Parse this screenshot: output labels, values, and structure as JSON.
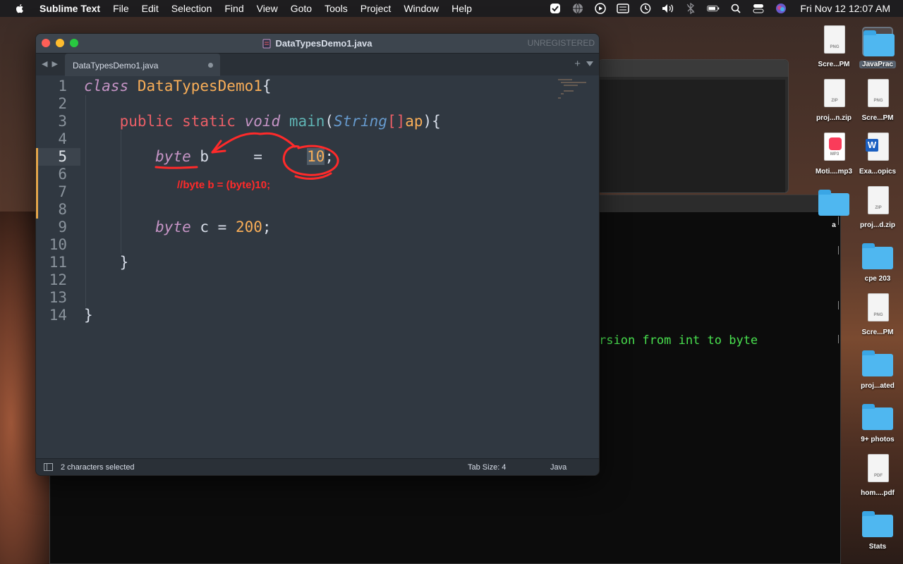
{
  "menubar": {
    "app_name": "Sublime Text",
    "items": [
      "File",
      "Edit",
      "Selection",
      "Find",
      "View",
      "Goto",
      "Tools",
      "Project",
      "Window",
      "Help"
    ],
    "clock": "Fri Nov 12  12:07 AM",
    "status_icons": [
      "checkbox-icon",
      "globe-icon",
      "play-icon",
      "keyboard-icon",
      "time-machine-icon",
      "volume-icon",
      "bluetooth-icon",
      "battery-icon",
      "search-icon",
      "control-center-icon",
      "siri-icon"
    ]
  },
  "editor_window": {
    "title": "DataTypesDemo1.java",
    "unregistered": "UNREGISTERED",
    "tab_label": "DataTypesDemo1.java",
    "line_numbers": [
      "1",
      "2",
      "3",
      "4",
      "5",
      "6",
      "7",
      "8",
      "9",
      "10",
      "11",
      "12",
      "13",
      "14"
    ],
    "active_line": 5,
    "code": {
      "l1_kw": "class",
      "l1_name": "DataTypesDemo1",
      "l1_brace": "{",
      "l3_public": "public",
      "l3_static": "static",
      "l3_void": "void",
      "l3_main": "main",
      "l3_paren_open": "(",
      "l3_string": "String",
      "l3_brackets": "[]",
      "l3_ap": "ap",
      "l3_close": "){",
      "l5_byte": "byte",
      "l5_var": " b     =     ",
      "l5_value": "10",
      "l5_semi": ";",
      "l9_byte": "byte",
      "l9_var": " c = ",
      "l9_value": "200",
      "l9_semi": ";",
      "l11_brace": "}",
      "l14_brace": "}"
    },
    "annotation_text": "//byte b = (byte)10;",
    "annotation_color": "#ff2a2a",
    "status": {
      "selection": "2 characters selected",
      "tab_size": "Tab Size: 4",
      "syntax": "Java"
    }
  },
  "terminal": {
    "visible_text": "rsion from int to byte"
  },
  "desktop_icons": [
    {
      "label": "Scre...PM",
      "type": "PNG"
    },
    {
      "label": "JavaPrac",
      "type": "folder",
      "selected": true
    },
    {
      "label": "proj...n.zip",
      "type": "ZIP"
    },
    {
      "label": "Scre...PM",
      "type": "PNG"
    },
    {
      "label": "Moti....mp3",
      "type": "MP3"
    },
    {
      "label": "Exa...opics",
      "type": "DOCX"
    },
    {
      "label": "a",
      "type": "folder"
    },
    {
      "label": "proj...d.zip",
      "type": "ZIP"
    },
    {
      "label": "cpe 203",
      "type": "folder"
    },
    {
      "label": "Scre...PM",
      "type": "PNG"
    },
    {
      "label": "proj...ated",
      "type": "folder"
    },
    {
      "label": "9+ photos",
      "type": "folder"
    },
    {
      "label": "hom....pdf",
      "type": "PDF"
    },
    {
      "label": "Stats",
      "type": "folder"
    }
  ],
  "colors": {
    "accent_modified": "#e5a54a",
    "editor_bg": "#303841",
    "terminal_text": "#49e04f"
  }
}
